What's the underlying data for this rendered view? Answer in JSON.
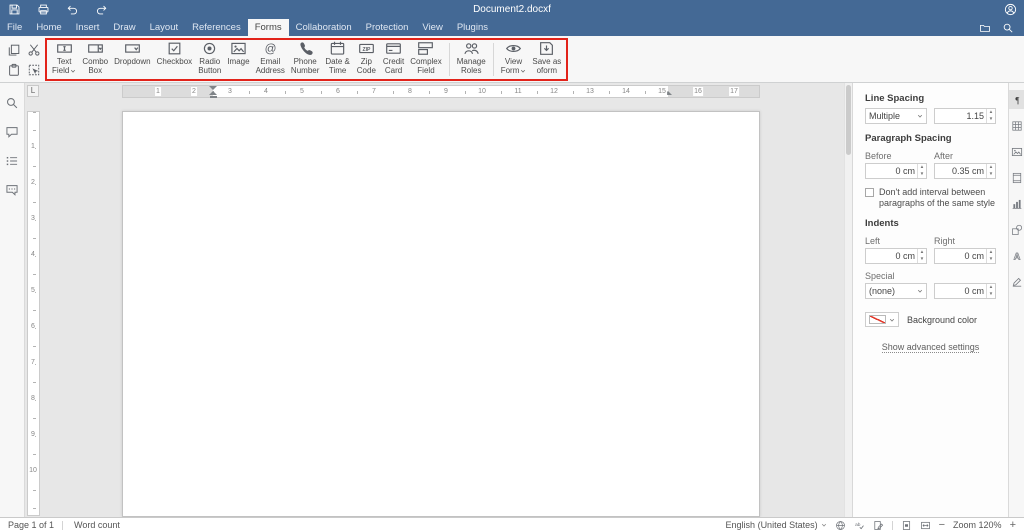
{
  "colors": {
    "header_bar": "#446995",
    "highlight_box": "#e2231a"
  },
  "header": {
    "title": "Document2.docxf"
  },
  "tabs": {
    "items": [
      "File",
      "Home",
      "Insert",
      "Draw",
      "Layout",
      "References",
      "Forms",
      "Collaboration",
      "Protection",
      "View",
      "Plugins"
    ],
    "active": "Forms"
  },
  "toolbar": {
    "clipboard": [
      "copy",
      "cut",
      "paste",
      "select-all"
    ],
    "form_buttons": [
      {
        "id": "text-field",
        "line1": "Text",
        "line2": "Field",
        "caret": true
      },
      {
        "id": "combo-box",
        "line1": "Combo",
        "line2": "Box"
      },
      {
        "id": "dropdown",
        "line1": "Dropdown"
      },
      {
        "id": "checkbox",
        "line1": "Checkbox"
      },
      {
        "id": "radio-button",
        "line1": "Radio",
        "line2": "Button"
      },
      {
        "id": "image",
        "line1": "Image"
      },
      {
        "id": "email-address",
        "line1": "Email",
        "line2": "Address"
      },
      {
        "id": "phone-number",
        "line1": "Phone",
        "line2": "Number"
      },
      {
        "id": "date-time",
        "line1": "Date &",
        "line2": "Time"
      },
      {
        "id": "zip-code",
        "line1": "Zip",
        "line2": "Code"
      },
      {
        "id": "credit-card",
        "line1": "Credit",
        "line2": "Card"
      },
      {
        "id": "complex-field",
        "line1": "Complex",
        "line2": "Field"
      },
      {
        "type": "separator"
      },
      {
        "id": "manage-roles",
        "line1": "Manage",
        "line2": "Roles"
      },
      {
        "type": "separator"
      },
      {
        "id": "view-form",
        "line1": "View",
        "line2": "Form",
        "caret": true
      },
      {
        "id": "save-as-oform",
        "line1": "Save as",
        "line2": "oform"
      }
    ]
  },
  "sidebar_left": [
    {
      "name": "search",
      "icon": "search"
    },
    {
      "name": "comments",
      "icon": "comments"
    },
    {
      "name": "navigation",
      "icon": "navigation"
    },
    {
      "name": "feedback",
      "icon": "feedback"
    }
  ],
  "sidebar_right": [
    {
      "name": "paragraph-settings",
      "icon": "paragraph",
      "active": true
    },
    {
      "name": "table-settings",
      "icon": "table"
    },
    {
      "name": "image-settings",
      "icon": "image"
    },
    {
      "name": "header-footer-settings",
      "icon": "headerfooter"
    },
    {
      "name": "chart-settings",
      "icon": "chart"
    },
    {
      "name": "shape-settings",
      "icon": "shape"
    },
    {
      "name": "text-art-settings",
      "icon": "textart"
    },
    {
      "name": "signature-settings",
      "icon": "signature"
    }
  ],
  "ruler": {
    "tab_selector": "L",
    "horizontal": [
      1,
      2,
      3,
      4,
      5,
      6,
      7,
      8,
      9,
      10,
      11,
      12,
      13,
      14,
      15,
      16,
      17
    ],
    "vertical": [
      1,
      2,
      3,
      4,
      5,
      6,
      7,
      8,
      9,
      10
    ]
  },
  "right_panel": {
    "line_spacing_title": "Line Spacing",
    "line_spacing_select": "Multiple",
    "line_spacing_value": "1.15",
    "paragraph_spacing_title": "Paragraph Spacing",
    "before_label": "Before",
    "after_label": "After",
    "before_value": "0 cm",
    "after_value": "0.35 cm",
    "interval_checkbox": "Don't add interval between paragraphs of the same style",
    "indents_title": "Indents",
    "left_label": "Left",
    "right_label": "Right",
    "left_value": "0 cm",
    "right_value": "0 cm",
    "special_label": "Special",
    "special_select": "(none)",
    "special_value": "0 cm",
    "background_label": "Background color",
    "advanced_link": "Show advanced settings"
  },
  "statusbar": {
    "page": "Page 1 of 1",
    "word_count": "Word count",
    "language": "English (United States)",
    "zoom": "Zoom 120%",
    "zoom_out": "−",
    "zoom_in": "+"
  }
}
